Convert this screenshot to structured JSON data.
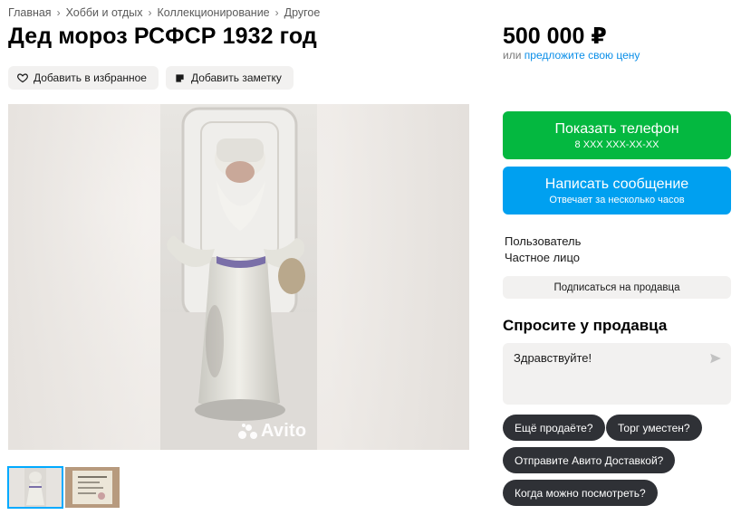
{
  "breadcrumb": [
    "Главная",
    "Хобби и отдых",
    "Коллекционирование",
    "Другое"
  ],
  "title": "Дед мороз РСФСР 1932 год",
  "actions": {
    "favorite": "Добавить в избранное",
    "note": "Добавить заметку"
  },
  "gallery": {
    "watermark": "Avito",
    "thumbnails_count": 2
  },
  "price": {
    "value": "500 000 ₽",
    "offer_prefix": "или",
    "offer_link": "предложите свою цену"
  },
  "phone_button": {
    "label": "Показать телефон",
    "sub": "8 XXX XXX-XX-XX"
  },
  "message_button": {
    "label": "Написать сообщение",
    "sub": "Отвечает за несколько часов"
  },
  "seller": {
    "name": "Пользователь",
    "type": "Частное лицо",
    "subscribe": "Подписаться на продавца"
  },
  "ask": {
    "title": "Спросите у продавца",
    "message": "Здравствуйте!",
    "quick_replies": [
      "Ещё продаёте?",
      "Торг уместен?",
      "Отправите Авито Доставкой?",
      "Когда можно посмотреть?"
    ]
  },
  "colors": {
    "green": "#04b840",
    "blue": "#00a0f0",
    "link": "#0a8ee8",
    "chip_bg": "#f2f1f0",
    "quick_bg": "#2f3136"
  },
  "icons": [
    "heart-icon",
    "note-icon",
    "chevron-right-icon",
    "send-icon",
    "avito-logo-icon"
  ]
}
